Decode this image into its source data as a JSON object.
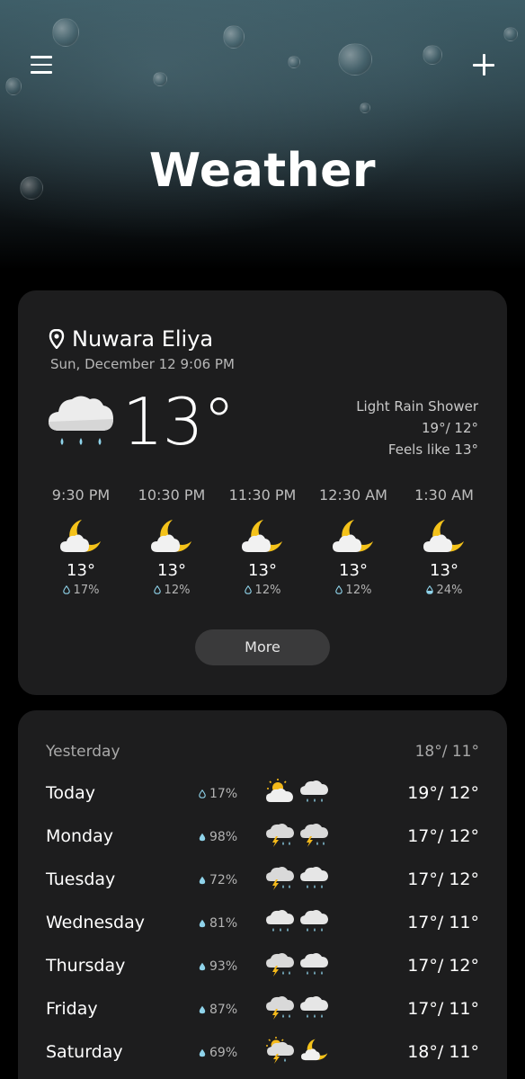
{
  "header": {
    "title": "Weather",
    "menu_icon": "menu-icon",
    "add_icon": "plus-icon"
  },
  "current": {
    "location": "Nuwara Eliya",
    "datetime": "Sun, December 12 9:06 PM",
    "temperature": "13°",
    "icon": "cloud-rain-icon",
    "condition": "Light Rain Shower",
    "high_low": "19°/ 12°",
    "feels_like": "Feels like 13°",
    "more_label": "More"
  },
  "hourly": [
    {
      "time": "9:30 PM",
      "temp": "13°",
      "rain": "17%",
      "icon": "moon-cloud-icon"
    },
    {
      "time": "10:30 PM",
      "temp": "13°",
      "rain": "12%",
      "icon": "moon-cloud-icon"
    },
    {
      "time": "11:30 PM",
      "temp": "13°",
      "rain": "12%",
      "icon": "moon-cloud-icon"
    },
    {
      "time": "12:30 AM",
      "temp": "13°",
      "rain": "12%",
      "icon": "moon-cloud-icon"
    },
    {
      "time": "1:30 AM",
      "temp": "13°",
      "rain": "24%",
      "icon": "moon-cloud-icon"
    }
  ],
  "yesterday": {
    "label": "Yesterday",
    "temps": "18°/ 11°"
  },
  "daily": [
    {
      "day": "Today",
      "rain": "17%",
      "day_icon": "sun-cloud-icon",
      "night_icon": "cloud-rain-icon",
      "temps": "19°/ 12°"
    },
    {
      "day": "Monday",
      "rain": "98%",
      "day_icon": "thunder-cloud-icon",
      "night_icon": "thunder-cloud-icon",
      "temps": "17°/ 12°"
    },
    {
      "day": "Tuesday",
      "rain": "72%",
      "day_icon": "thunder-cloud-icon",
      "night_icon": "cloud-rain-icon",
      "temps": "17°/ 12°"
    },
    {
      "day": "Wednesday",
      "rain": "81%",
      "day_icon": "cloud-rain-icon",
      "night_icon": "cloud-rain-icon",
      "temps": "17°/ 11°"
    },
    {
      "day": "Thursday",
      "rain": "93%",
      "day_icon": "thunder-cloud-icon",
      "night_icon": "cloud-rain-icon",
      "temps": "17°/ 12°"
    },
    {
      "day": "Friday",
      "rain": "87%",
      "day_icon": "thunder-cloud-icon",
      "night_icon": "cloud-rain-icon",
      "temps": "17°/ 11°"
    },
    {
      "day": "Saturday",
      "rain": "69%",
      "day_icon": "sun-thunder-icon",
      "night_icon": "moon-cloud-icon",
      "temps": "18°/ 11°"
    }
  ],
  "colors": {
    "background": "#000000",
    "card": "#1d1d1e",
    "moon": "#f4c21a",
    "sun": "#f4b91a",
    "drop": "#8fd3ea"
  }
}
